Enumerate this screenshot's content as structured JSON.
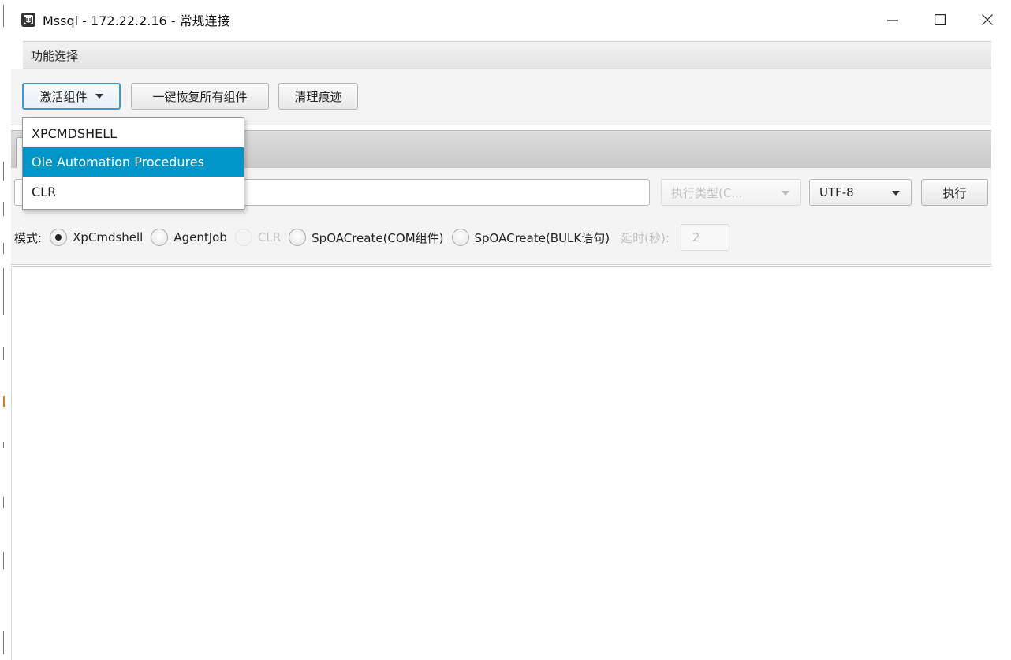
{
  "window": {
    "title": "Mssql - 172.22.2.16 - 常规连接",
    "controls": {
      "minimize": "—",
      "maximize": "☐",
      "close": "✕"
    }
  },
  "section": {
    "title": "功能选择"
  },
  "toolbar": {
    "activate_label": "激活组件",
    "restore_label": "一键恢复所有组件",
    "clean_label": "清理痕迹"
  },
  "dropdown": {
    "items": [
      "XPCMDSHELL",
      "Ole Automation Procedures",
      "CLR"
    ],
    "selected_index": 1
  },
  "command": {
    "input_value": "",
    "exec_type_placeholder": "执行类型(C...",
    "encoding": "UTF-8",
    "execute_label": "执行"
  },
  "mode": {
    "label": "模式:",
    "options": [
      {
        "label": "XpCmdshell",
        "checked": true,
        "disabled": false
      },
      {
        "label": "AgentJob",
        "checked": false,
        "disabled": false
      },
      {
        "label": "CLR",
        "checked": false,
        "disabled": true
      },
      {
        "label": "SpOACreate(COM组件)",
        "checked": false,
        "disabled": false
      },
      {
        "label": "SpOACreate(BULK语句)",
        "checked": false,
        "disabled": false
      }
    ],
    "delay_label": "延时(秒):",
    "delay_value": "2"
  },
  "colors": {
    "accent": "#0096c9",
    "focus_border": "#3a9bd8"
  }
}
